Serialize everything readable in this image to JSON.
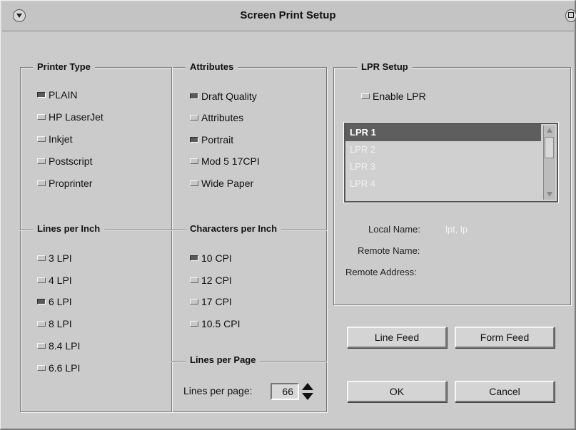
{
  "window": {
    "title": "Screen Print Setup"
  },
  "printer_type": {
    "title": "Printer Type",
    "options": [
      {
        "label": "PLAIN",
        "checked": true
      },
      {
        "label": "HP LaserJet",
        "checked": false
      },
      {
        "label": "Inkjet",
        "checked": false
      },
      {
        "label": "Postscript",
        "checked": false
      },
      {
        "label": "Proprinter",
        "checked": false
      }
    ]
  },
  "attributes": {
    "title": "Attributes",
    "options": [
      {
        "label": "Draft Quality",
        "checked": true
      },
      {
        "label": "Attributes",
        "checked": false
      },
      {
        "label": "Portrait",
        "checked": true
      },
      {
        "label": "Mod 5 17CPI",
        "checked": false
      },
      {
        "label": "Wide Paper",
        "checked": false
      }
    ]
  },
  "lines_per_inch": {
    "title": "Lines per Inch",
    "options": [
      {
        "label": "3 LPI",
        "checked": false
      },
      {
        "label": "4 LPI",
        "checked": false
      },
      {
        "label": "6 LPI",
        "checked": true
      },
      {
        "label": "8 LPI",
        "checked": false
      },
      {
        "label": "8.4 LPI",
        "checked": false
      },
      {
        "label": "6.6 LPI",
        "checked": false
      }
    ]
  },
  "characters_per_inch": {
    "title": "Characters per Inch",
    "options": [
      {
        "label": "10 CPI",
        "checked": true
      },
      {
        "label": "12 CPI",
        "checked": false
      },
      {
        "label": "17 CPI",
        "checked": false
      },
      {
        "label": "10.5 CPI",
        "checked": false
      }
    ]
  },
  "lines_per_page": {
    "title": "Lines per Page",
    "label": "Lines per page:",
    "value": "66"
  },
  "lpr_setup": {
    "title": "LPR Setup",
    "enable_label": "Enable LPR",
    "enable_checked": false,
    "list": [
      "LPR 1",
      "LPR 2",
      "LPR 3",
      "LPR 4"
    ],
    "selected_index": 0,
    "local_name_label": "Local Name:",
    "local_name_value": "lpt, lp",
    "remote_name_label": "Remote Name:",
    "remote_address_label": "Remote Address:"
  },
  "buttons": {
    "line_feed": "Line Feed",
    "form_feed": "Form Feed",
    "ok": "OK",
    "cancel": "Cancel"
  }
}
